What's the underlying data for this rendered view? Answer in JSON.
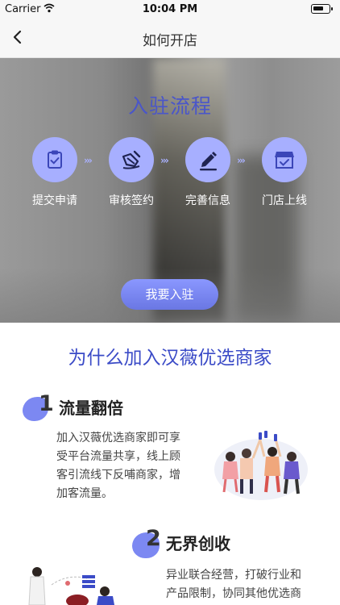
{
  "status": {
    "carrier": "Carrier",
    "time": "10:04 PM"
  },
  "nav": {
    "title": "如何开店",
    "back_icon": "chevron-left-icon"
  },
  "hero": {
    "heading": "入驻流程",
    "steps": [
      {
        "label": "提交申请",
        "icon": "clipboard-check-icon"
      },
      {
        "label": "审核签约",
        "icon": "signing-hand-icon"
      },
      {
        "label": "完善信息",
        "icon": "pen-edit-icon"
      },
      {
        "label": "门店上线",
        "icon": "storefront-icon"
      }
    ],
    "arrow_glyph": "›››",
    "join_button": "我要入驻"
  },
  "why": {
    "title": "为什么加入汉薇优选商家"
  },
  "features": [
    {
      "number": "1",
      "title": "流量翻倍",
      "lines": [
        "加入汉薇优选商家即可享",
        "受平台流量共享，线上顾",
        "客引流线下反哺商家，增",
        "加客流量。"
      ]
    },
    {
      "number": "2",
      "title": "无界创收",
      "lines": [
        "异业联合经营，打破行业和",
        "产品限制，协同其他优选商"
      ]
    }
  ],
  "colors": {
    "accent": "#3b4bc7",
    "step_circle": "#a7afff",
    "blob": "#7c88f2"
  }
}
